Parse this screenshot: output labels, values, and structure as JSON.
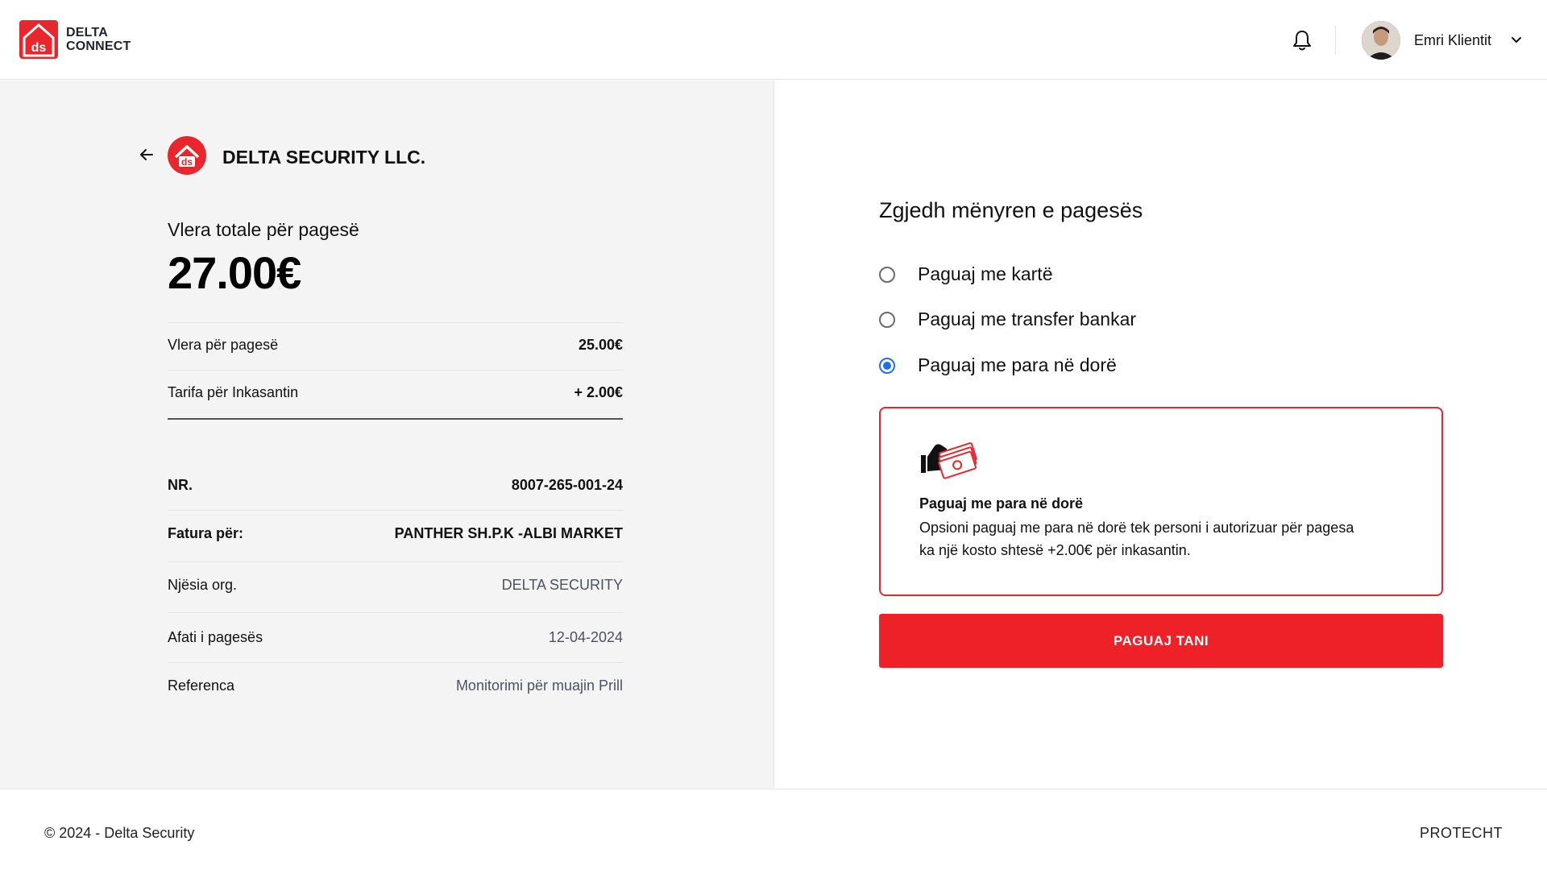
{
  "header": {
    "logo_line1": "DELTA",
    "logo_line2": "CONNECT",
    "logo_mark": "ds",
    "user_name": "Emri Klientit"
  },
  "invoice": {
    "company_name": "DELTA SECURITY LLC.",
    "company_mark": "ds",
    "total_label": "Vlera totale për pagesë",
    "total_amount": "27.00€",
    "amount_rows": [
      {
        "label": "Vlera për pagesë",
        "value": "25.00€"
      },
      {
        "label": "Tarifa për Inkasantin",
        "value": "+ 2.00€"
      }
    ],
    "detail_rows": [
      {
        "label": "NR.",
        "value": "8007-265-001-24"
      },
      {
        "label": "Fatura për:",
        "value": "PANTHER SH.P.K -ALBI MARKET"
      },
      {
        "label": "Njësia org.",
        "value": "DELTA SECURITY"
      },
      {
        "label": "Afati i pagesës",
        "value": "12-04-2024"
      },
      {
        "label": "Referenca",
        "value": "Monitorimi për muajin Prill"
      }
    ]
  },
  "payment": {
    "title": "Zgjedh mënyren e pagesës",
    "options": [
      {
        "label": "Paguaj me kartë",
        "selected": false
      },
      {
        "label": "Paguaj me transfer bankar",
        "selected": false
      },
      {
        "label": "Paguaj me para në dorë",
        "selected": true
      }
    ],
    "info_title": "Paguaj me para në dorë",
    "info_text_line1": "Opsioni paguaj me para në dorë tek personi i autorizuar për pagesa",
    "info_text_line2": "ka një kosto shtesë +2.00€ për inkasantin.",
    "pay_button": "PAGUAJ TANI"
  },
  "footer": {
    "copyright": "© 2024 - Delta Security",
    "brand_link": "PROTECHT"
  },
  "icons": {
    "bell": "bell-icon",
    "chevron": "chevron-down-icon",
    "back": "arrow-left-icon",
    "cash": "cash-hand-icon"
  },
  "colors": {
    "brand_red": "#ee2128",
    "radio_blue": "#1f6feb",
    "panel_gray": "#f4f4f4"
  }
}
